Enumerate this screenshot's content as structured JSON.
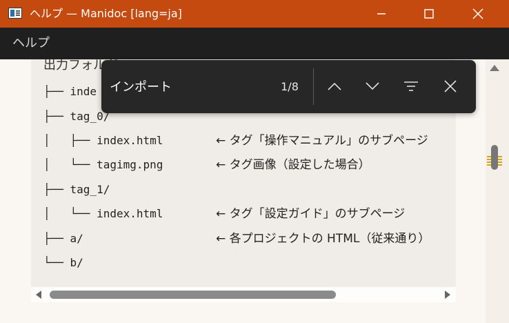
{
  "window": {
    "title": "ヘルプ — Manidoc [lang=ja]",
    "buttons": [
      "minimize",
      "maximize",
      "close"
    ]
  },
  "menubar": {
    "help_label": "ヘルプ"
  },
  "document": {
    "heading": "出力フォルダ",
    "tree": [
      {
        "text": "├── inde"
      },
      {
        "text": "├── tag_0/"
      },
      {
        "text": "│   ├── index.html",
        "note": "← タグ「操作マニュアル」のサブページ"
      },
      {
        "text": "│   └── tagimg.png",
        "note": "← タグ画像（設定した場合）"
      },
      {
        "text": "├── tag_1/"
      },
      {
        "text": "│   └── index.html",
        "note": "← タグ「設定ガイド」のサブページ"
      },
      {
        "text": "├── a/",
        "note": "← 各プロジェクトの HTML（従来通り）"
      },
      {
        "text": "└── b/"
      }
    ]
  },
  "findbar": {
    "query": "インポート",
    "match_count": "1/8"
  },
  "colors": {
    "titlebar": "#c54a10",
    "menubar": "#1f1f1f",
    "findbar": "#272727",
    "search_marks": "#d4a514"
  }
}
